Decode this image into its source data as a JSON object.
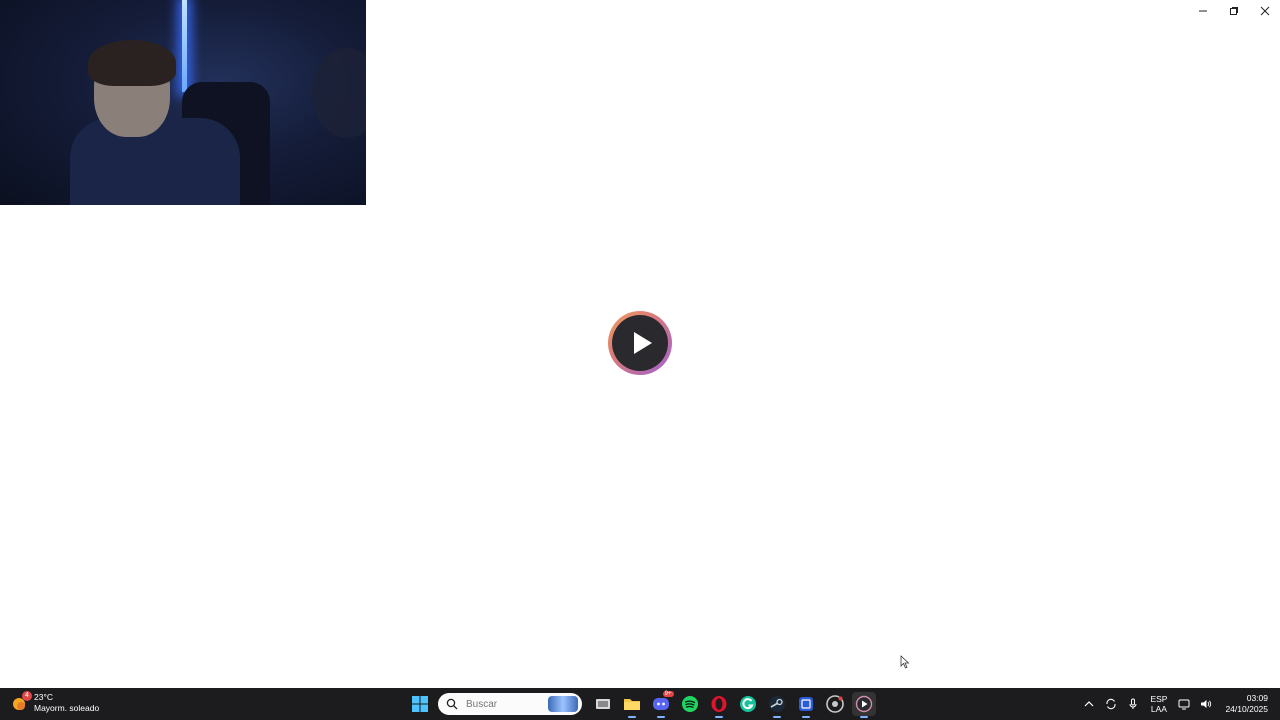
{
  "window": {
    "controls": [
      {
        "name": "minimize-button",
        "icon": "minimize-icon"
      },
      {
        "name": "restore-button",
        "icon": "restore-icon"
      },
      {
        "name": "close-button",
        "icon": "close-icon"
      }
    ]
  },
  "player": {
    "play_icon": "play-icon",
    "accent_colors": [
      "#f0a060",
      "#a060d0"
    ]
  },
  "taskbar": {
    "weather": {
      "temperature": "23°C",
      "condition": "Mayorm. soleado",
      "badge": "4"
    },
    "search": {
      "placeholder": "Buscar"
    },
    "apps": [
      {
        "name": "start-button",
        "icon": "windows-logo-icon"
      },
      {
        "name": "task-view-button",
        "icon": "task-view-icon"
      },
      {
        "name": "file-explorer-button",
        "icon": "folder-icon"
      },
      {
        "name": "discord-button",
        "icon": "discord-icon",
        "badge": "9+"
      },
      {
        "name": "spotify-button",
        "icon": "spotify-icon"
      },
      {
        "name": "opera-button",
        "icon": "opera-icon"
      },
      {
        "name": "grammarly-button",
        "icon": "grammarly-icon"
      },
      {
        "name": "steam-button",
        "icon": "steam-icon"
      },
      {
        "name": "app-blue-button",
        "icon": "app-icon"
      },
      {
        "name": "app-chrome-button",
        "icon": "chrome-icon"
      },
      {
        "name": "media-player-button",
        "icon": "play-icon"
      }
    ],
    "tray": {
      "language_top": "ESP",
      "language_bottom": "LAA",
      "time": "03:09",
      "date": "24/10/2025"
    }
  }
}
